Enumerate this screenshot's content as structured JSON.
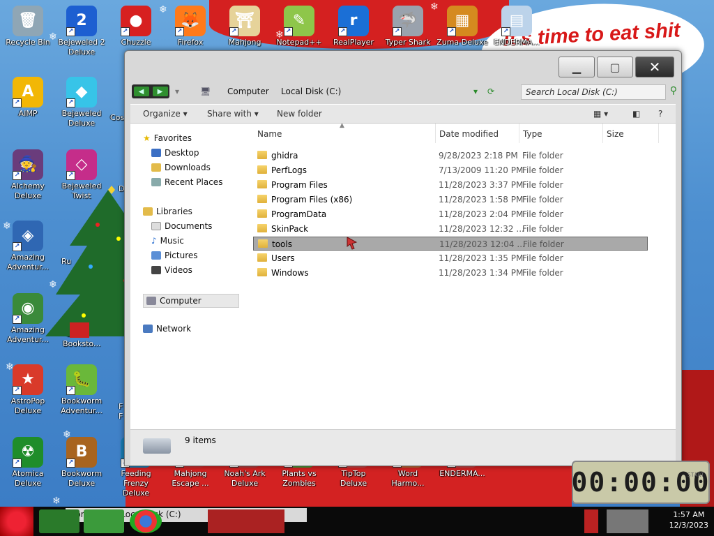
{
  "desktop": {
    "banner_text": "it's time to eat shit",
    "icons": [
      {
        "label": "Recycle Bin",
        "color": "#8fa6b5",
        "glyph": "🗑"
      },
      {
        "label": "Bejeweled 2 Deluxe",
        "color": "#1d5fd1",
        "glyph": "2"
      },
      {
        "label": "Chuzzle",
        "color": "#d72020",
        "glyph": "●"
      },
      {
        "label": "Firefox",
        "color": "#ff7a1a",
        "glyph": "🦊"
      },
      {
        "label": "Mahjong",
        "color": "#e6d39a",
        "glyph": "⛩"
      },
      {
        "label": "Notepad++",
        "color": "#8ec64a",
        "glyph": "✎"
      },
      {
        "label": "RealPlayer",
        "color": "#1b6fd6",
        "glyph": "r"
      },
      {
        "label": "Typer Shark",
        "color": "#9aa2ad",
        "glyph": "🦈"
      },
      {
        "label": "Zuma Deluxe",
        "color": "#d58a1f",
        "glyph": "▦"
      },
      {
        "label": "ENDERMA...",
        "color": "#bcd3ea",
        "glyph": "▤"
      },
      {
        "label": "AIMP",
        "color": "#f2b705",
        "glyph": "A"
      },
      {
        "label": "Bejeweled Deluxe",
        "color": "#37c4e8",
        "glyph": "◆"
      },
      {
        "label": "Alchemy Deluxe",
        "color": "#6a3c7c",
        "glyph": "🧙"
      },
      {
        "label": "Bejeweled Twist",
        "color": "#c52d8a",
        "glyph": "◇"
      },
      {
        "label": "Amazing Adventur...",
        "color": "#2f67b3",
        "glyph": "◈"
      },
      {
        "label": "Amazing Adventur...",
        "color": "#3a8a3a",
        "glyph": "◉"
      },
      {
        "label": "AstroPop Deluxe",
        "color": "#d93a2a",
        "glyph": "★"
      },
      {
        "label": "Bookworm Adventur...",
        "color": "#6ab83a",
        "glyph": "🐛"
      },
      {
        "label": "Atomica Deluxe",
        "color": "#1f8d2a",
        "glyph": "☢"
      },
      {
        "label": "Bookworm Deluxe",
        "color": "#a8641f",
        "glyph": "B"
      },
      {
        "label": "Feeding Frenzy Deluxe",
        "color": "#1a7fb8",
        "glyph": "🐟"
      },
      {
        "label": "Mahjong Escape ...",
        "color": "#c83030",
        "glyph": "M"
      },
      {
        "label": "Noah's Ark Deluxe",
        "color": "#b04040",
        "glyph": "N"
      },
      {
        "label": "Plants vs Zombies",
        "color": "#4a9a3a",
        "glyph": "P"
      },
      {
        "label": "TipTop Deluxe",
        "color": "#c04a4a",
        "glyph": "T"
      },
      {
        "label": "Word Harmo...",
        "color": "#b86a3a",
        "glyph": "W"
      },
      {
        "label": "ENDERMA...",
        "color": "#c04848",
        "glyph": "E"
      }
    ],
    "partial_labels": [
      "Cos",
      "D",
      "Ru",
      "Bo",
      "Booksto...",
      "F",
      "F"
    ]
  },
  "window": {
    "breadcrumb": [
      "Computer",
      "Local Disk (C:)"
    ],
    "search_placeholder": "Search Local Disk (C:)",
    "toolbar": {
      "organize": "Organize",
      "share": "Share with",
      "new_folder": "New folder",
      "help": "?"
    },
    "nav": {
      "favorites": "Favorites",
      "fav_items": [
        "Desktop",
        "Downloads",
        "Recent Places"
      ],
      "libraries": "Libraries",
      "lib_items": [
        "Documents",
        "Music",
        "Pictures",
        "Videos"
      ],
      "computer": "Computer",
      "network": "Network"
    },
    "columns": {
      "name": "Name",
      "date": "Date modified",
      "type": "Type",
      "size": "Size"
    },
    "files": [
      {
        "name": "ghidra",
        "date": "9/28/2023 2:18 PM",
        "type": "File folder"
      },
      {
        "name": "PerfLogs",
        "date": "7/13/2009 11:20 PM",
        "type": "File folder"
      },
      {
        "name": "Program Files",
        "date": "11/28/2023 3:37 PM",
        "type": "File folder"
      },
      {
        "name": "Program Files (x86)",
        "date": "11/28/2023 1:58 PM",
        "type": "File folder"
      },
      {
        "name": "ProgramData",
        "date": "11/28/2023 2:04 PM",
        "type": "File folder"
      },
      {
        "name": "SkinPack",
        "date": "11/28/2023 12:32 ...",
        "type": "File folder"
      },
      {
        "name": "tools",
        "date": "11/28/2023 12:04 ...",
        "type": "File folder",
        "selected": true
      },
      {
        "name": "Users",
        "date": "11/28/2023 1:35 PM",
        "type": "File folder"
      },
      {
        "name": "Windows",
        "date": "11/28/2023 1:34 PM",
        "type": "File folder"
      }
    ],
    "status_count": "9 items"
  },
  "timer": {
    "display": "00:00:00",
    "start_label": "START"
  },
  "taskbar": {
    "active_label": "Computer ▸ Local Disk (C:)",
    "time": "1:57 AM",
    "date": "12/3/2023"
  }
}
